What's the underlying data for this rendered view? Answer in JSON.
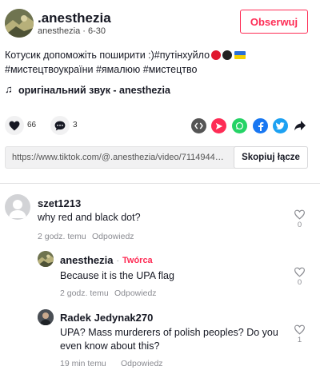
{
  "header": {
    "username": ".anesthezia",
    "handle": "anesthezia",
    "date": "6-30",
    "follow_label": "Obserwuj"
  },
  "description": {
    "line1": "Котусик допоможіть поширити :)#путінхуйло",
    "line2": "#мистецтвоукраїни #ямалюю #мистецтво"
  },
  "sound": {
    "label": "оригінальний звук - anesthezia"
  },
  "actions": {
    "likes": "66",
    "comments": "3"
  },
  "link": {
    "url": "https://www.tiktok.com/@.anesthezia/video/7114944270...",
    "copy_label": "Skopiuj łącze"
  },
  "comments": [
    {
      "author": "szet1213",
      "text": "why red and black dot?",
      "time": "2 godz. temu",
      "reply_label": "Odpowiedz",
      "likes": "0"
    },
    {
      "author": "anesthezia",
      "badge": "Twórca",
      "separator": "·",
      "text": "Because it is the UPA flag",
      "time": "2 godz. temu",
      "reply_label": "Odpowiedz",
      "likes": "0"
    },
    {
      "author": "Radek Jedynak270",
      "text": "UPA? Mass murderers of polish peoples? Do you even know about this?",
      "time": "19 min temu",
      "reply_label": "Odpowiedz",
      "likes": "1"
    }
  ],
  "colors": {
    "accent": "#fe2c55",
    "muted": "#8a8b91",
    "flag_red": "#e0182e",
    "flag_black": "#222222"
  }
}
